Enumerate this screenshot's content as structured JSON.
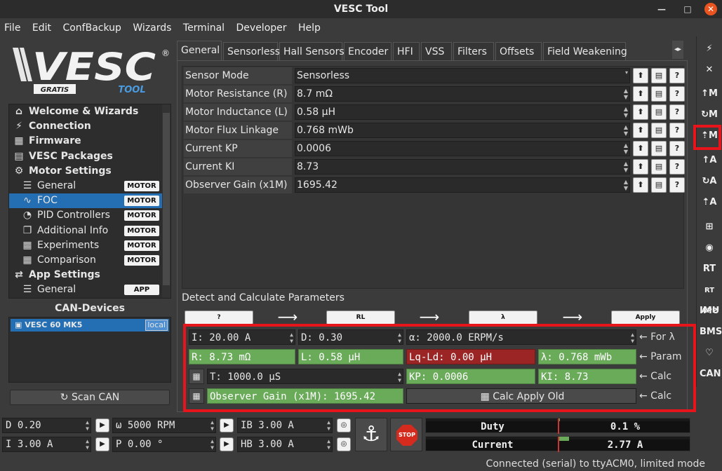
{
  "window": {
    "title": "VESC Tool"
  },
  "menu": [
    "File",
    "Edit",
    "ConfBackup",
    "Wizards",
    "Terminal",
    "Developer",
    "Help"
  ],
  "logo": {
    "text": "VESC",
    "sub_left": "GRATIS",
    "sub_right": "TOOL",
    "reg": "®"
  },
  "nav": [
    {
      "label": "Welcome & Wizards",
      "icon": "home-icon",
      "glyph": "⌂",
      "level": "top"
    },
    {
      "label": "Connection",
      "icon": "plug-icon",
      "glyph": "⚡",
      "level": "top"
    },
    {
      "label": "Firmware",
      "icon": "chip-icon",
      "glyph": "▦",
      "level": "top"
    },
    {
      "label": "VESC Packages",
      "icon": "package-icon",
      "glyph": "▤",
      "level": "top"
    },
    {
      "label": "Motor Settings",
      "icon": "motor-icon",
      "glyph": "⚙",
      "level": "top"
    },
    {
      "label": "General",
      "icon": "sliders-icon",
      "glyph": "☰",
      "level": "sub",
      "badge": "MOTOR"
    },
    {
      "label": "FOC",
      "icon": "foc-icon",
      "glyph": "∿",
      "level": "sub",
      "badge": "MOTOR",
      "selected": true
    },
    {
      "label": "PID Controllers",
      "icon": "gauge-icon",
      "glyph": "◔",
      "level": "sub",
      "badge": "MOTOR"
    },
    {
      "label": "Additional Info",
      "icon": "info-icon",
      "glyph": "❐",
      "level": "sub",
      "badge": "MOTOR"
    },
    {
      "label": "Experiments",
      "icon": "calculator-icon",
      "glyph": "▦",
      "level": "sub",
      "badge": "MOTOR"
    },
    {
      "label": "Comparison",
      "icon": "calculator-icon",
      "glyph": "▦",
      "level": "sub",
      "badge": "MOTOR"
    },
    {
      "label": "App Settings",
      "icon": "arrows-icon",
      "glyph": "⇄",
      "level": "top"
    },
    {
      "label": "General",
      "icon": "sliders-icon",
      "glyph": "☰",
      "level": "sub",
      "badge": "APP"
    }
  ],
  "can": {
    "title": "CAN-Devices",
    "device": "VESC 60 MK5",
    "tag": "local",
    "scan_label": "Scan CAN"
  },
  "tabs": [
    "General",
    "Sensorless",
    "Hall Sensors",
    "Encoder",
    "HFI",
    "VSS",
    "Filters",
    "Offsets",
    "Field Weakening"
  ],
  "params": [
    {
      "label": "Sensor Mode",
      "value": "Sensorless",
      "combo": true
    },
    {
      "label": "Motor Resistance (R)",
      "value": "8.7 mΩ"
    },
    {
      "label": "Motor Inductance (L)",
      "value": "0.58 µH"
    },
    {
      "label": "Motor Flux Linkage (λ)",
      "value": "0.768 mWb"
    },
    {
      "label": "Current KP",
      "value": "0.0006"
    },
    {
      "label": "Current KI",
      "value": "8.73"
    },
    {
      "label": "Observer Gain (x1M)",
      "value": "1695.42"
    }
  ],
  "detect": {
    "title": "Detect and Calculate Parameters",
    "buttons": [
      "?",
      "RL",
      "λ",
      "Apply"
    ],
    "row1": {
      "i": "I: 20.00 A",
      "d": "D: 0.30",
      "alpha": "α: 2000.0 ERPM/s",
      "label": "← For λ"
    },
    "row2": {
      "r": "R: 8.73 mΩ",
      "l": "L: 0.58 µH",
      "lqld": "Lq-Ld: 0.00 µH",
      "lambda": "λ: 0.768 mWb",
      "label": "← Param"
    },
    "row3": {
      "t": "T: 1000.0 µS",
      "kp": "KP: 0.0006",
      "ki": "KI: 8.73",
      "label": "← Calc"
    },
    "row4": {
      "gain": "Observer Gain (x1M): 1695.42",
      "apply_old": "Calc Apply Old",
      "label": "← Calc"
    }
  },
  "right_toolbar": [
    "plug-icon",
    "unplug-icon",
    "↑M",
    "↻M",
    "⇡M",
    "↑A",
    "↻A",
    "⇡A",
    "network-icon",
    "gamepad-icon",
    "RT",
    "RT APP",
    "IMU",
    "BMS",
    "heart-icon",
    "CAN"
  ],
  "bottom": {
    "d": "D 0.20",
    "rpm": "ω 5000 RPM",
    "ib": "IB 3.00 A",
    "i": "I 3.00 A",
    "p": "P 0.00 °",
    "hb": "HB 3.00 A",
    "stop": "STOP"
  },
  "meters": [
    {
      "label": "Duty",
      "value": "0.1 %",
      "fraction": 0.001
    },
    {
      "label": "Current",
      "value": "2.77 A",
      "fraction": 0.02
    }
  ],
  "status": "Connected (serial) to ttyACM0, limited mode",
  "colors": {
    "accent": "#246fb3",
    "green": "#6aab5a",
    "red": "#9b2424",
    "highlight": "#e8141b",
    "close": "#e95420"
  }
}
